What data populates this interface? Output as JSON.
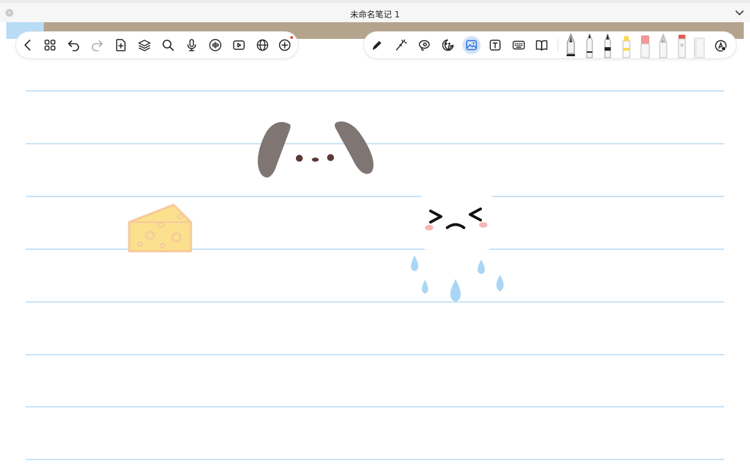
{
  "window": {
    "title": "未命名笔记 1"
  },
  "icons": {
    "close": "close-icon",
    "collapse": "chevron-down-icon"
  },
  "toolbar_left": [
    "back-icon",
    "grid-icon",
    "undo-icon",
    "redo-icon",
    "add-page-icon",
    "layers-icon",
    "search-icon",
    "microphone-icon",
    "audio-wave-icon",
    "video-icon",
    "globe-icon",
    "add-circle-icon"
  ],
  "toolbar_right": [
    "pen-icon",
    "magic-wand-icon",
    "lasso-icon",
    "sticker-icon",
    "image-icon",
    "text-icon",
    "keyboard-icon",
    "book-icon"
  ],
  "pens": [
    "fountain-pen",
    "ballpoint-pen",
    "fineliner-pen",
    "highlighter",
    "eraser",
    "pencil",
    "correction-pen",
    "ruler"
  ],
  "active_tool": "image-icon",
  "colors": {
    "ruled_lines": "#c9e2f6",
    "band": "#b5a48d",
    "tab": "#b9dcf5",
    "active_tool_bg": "#cfe3fa",
    "ear": "#7f7573",
    "cheese": "#fbe08d",
    "drop": "#a9d6f5"
  },
  "stickers": [
    "dog-ears-face",
    "cheese-wedge",
    "crying-ghost-face"
  ]
}
